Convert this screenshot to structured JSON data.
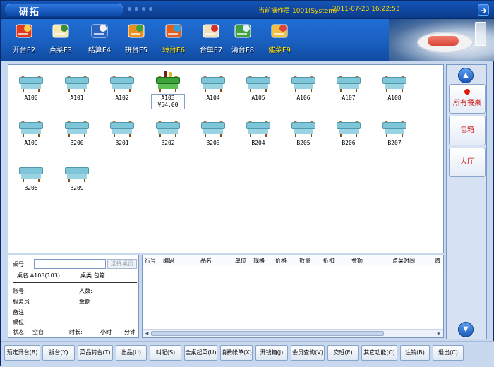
{
  "window": {
    "title": "研拓",
    "operator": "当前操作员:1001(System)",
    "datetime": "2011-07-23 16:22:53"
  },
  "toolbar": [
    {
      "label": "开台F2",
      "icon": "open-table-icon"
    },
    {
      "label": "点菜F3",
      "icon": "order-icon"
    },
    {
      "label": "结算F4",
      "icon": "checkout-icon"
    },
    {
      "label": "拼台F5",
      "icon": "merge-table-icon"
    },
    {
      "label": "转台F6",
      "icon": "transfer-table-icon"
    },
    {
      "label": "合单F7",
      "icon": "merge-bill-icon"
    },
    {
      "label": "清台F8",
      "icon": "clear-table-icon"
    },
    {
      "label": "催菜F9",
      "icon": "rush-dish-icon"
    }
  ],
  "tables": [
    {
      "name": "A100",
      "occupied": false
    },
    {
      "name": "A101",
      "occupied": false
    },
    {
      "name": "A102",
      "occupied": false
    },
    {
      "name": "A103",
      "occupied": true,
      "amount": "¥54.00"
    },
    {
      "name": "A104",
      "occupied": false
    },
    {
      "name": "A105",
      "occupied": false
    },
    {
      "name": "A106",
      "occupied": false
    },
    {
      "name": "A107",
      "occupied": false
    },
    {
      "name": "A108",
      "occupied": false
    },
    {
      "name": "A109",
      "occupied": false
    },
    {
      "name": "B200",
      "occupied": false
    },
    {
      "name": "B201",
      "occupied": false
    },
    {
      "name": "B202",
      "occupied": false
    },
    {
      "name": "B203",
      "occupied": false
    },
    {
      "name": "B204",
      "occupied": false
    },
    {
      "name": "B205",
      "occupied": false
    },
    {
      "name": "B206",
      "occupied": false
    },
    {
      "name": "B207",
      "occupied": false
    },
    {
      "name": "B208",
      "occupied": false
    },
    {
      "name": "B209",
      "occupied": false
    }
  ],
  "side": {
    "all_tables": "所有餐桌",
    "private_room": "包箱",
    "hall": "大厅"
  },
  "info": {
    "table_no_label": "桌号:",
    "select_table": "选择桌员",
    "table_name": "桌名:A103(103)",
    "table_type": "桌类:包箱",
    "account_label": "账号:",
    "people_label": "人数:",
    "waiter_label": "服务员:",
    "amount_label": "金额:",
    "remark_label": "备注:",
    "seat_label": "桌位:",
    "status_label": "状态:",
    "status_value": "空台",
    "duration_label": "时长:",
    "hours": "小时",
    "minutes": "分钟"
  },
  "grid_headers": [
    "行号",
    "编码",
    "品名",
    "单位",
    "规格",
    "价格",
    "数量",
    "折扣",
    "金额",
    "点菜时间",
    "赠"
  ],
  "buttons": [
    "预定开台(B)",
    "拆台(Y)",
    "菜品转台(T)",
    "出品(U)",
    "叫起(S)",
    "全桌起菜(U)",
    "消费帐单(X)",
    "开钱箱(J)",
    "会员查询(V)",
    "交班(E)",
    "其它功能(O)",
    "注销(B)",
    "退出(C)"
  ],
  "colors": {
    "titlebar": "#0a3a8a",
    "toolbar": "#1a5fbf",
    "accent_yellow": "#ffd800",
    "occupied_table": "#3ea23a",
    "free_table": "#7ec6d8",
    "side_red": "#c8100b"
  }
}
